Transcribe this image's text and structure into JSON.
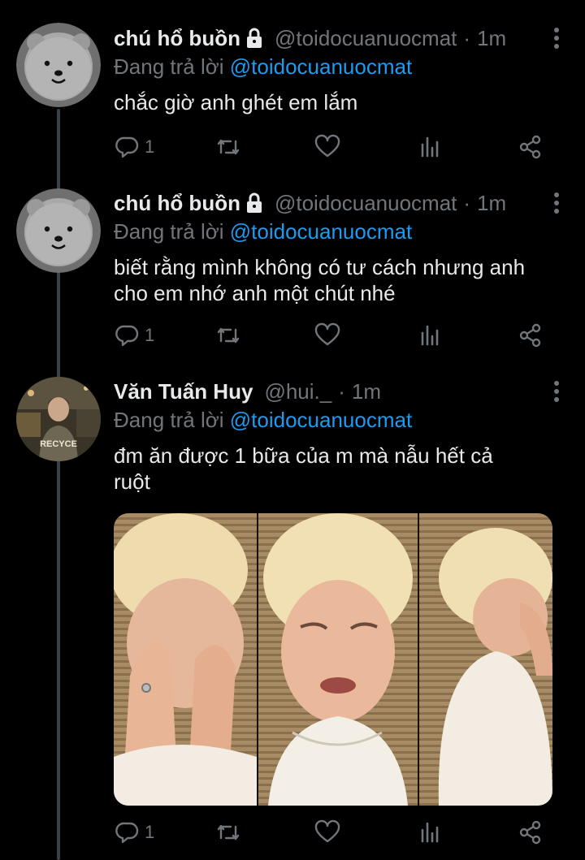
{
  "colors": {
    "background": "#000000",
    "text": "#e7e9ea",
    "muted": "#71767b",
    "mention": "#1d9bf0",
    "thread_line": "#3c4146"
  },
  "tweets": [
    {
      "name": "chú hổ buồn",
      "locked": true,
      "handle": "@toidocuanuocmat",
      "separator": "·",
      "time": "1m",
      "reply_prefix": "Đang trả lời ",
      "reply_to": "@toidocuanuocmat",
      "text": "chắc giờ anh ghét em lắm",
      "reply_count": "1",
      "avatar_icon": "white-bear-avatar"
    },
    {
      "name": "chú hổ buồn",
      "locked": true,
      "handle": "@toidocuanuocmat",
      "separator": "·",
      "time": "1m",
      "reply_prefix": "Đang trả lời ",
      "reply_to": "@toidocuanuocmat",
      "text_lines": [
        "biết rằng mình không có tư cách nhưng anh",
        "cho em nhớ anh một chút nhé"
      ],
      "reply_count": "1",
      "avatar_icon": "white-bear-avatar"
    },
    {
      "name": "Văn Tuấn Huy",
      "locked": false,
      "handle": "@hui._",
      "separator": "·",
      "time": "1m",
      "reply_prefix": "Đang trả lời ",
      "reply_to": "@toidocuanuocmat",
      "text_lines": [
        "đm ăn được 1 bữa của m mà nẫu hết cả",
        "ruột"
      ],
      "reply_count": "1",
      "avatar_icon": "person-photo-avatar",
      "avatar_shirt_text": "RECYCE",
      "media": "crying-person-photo-collage"
    }
  ]
}
